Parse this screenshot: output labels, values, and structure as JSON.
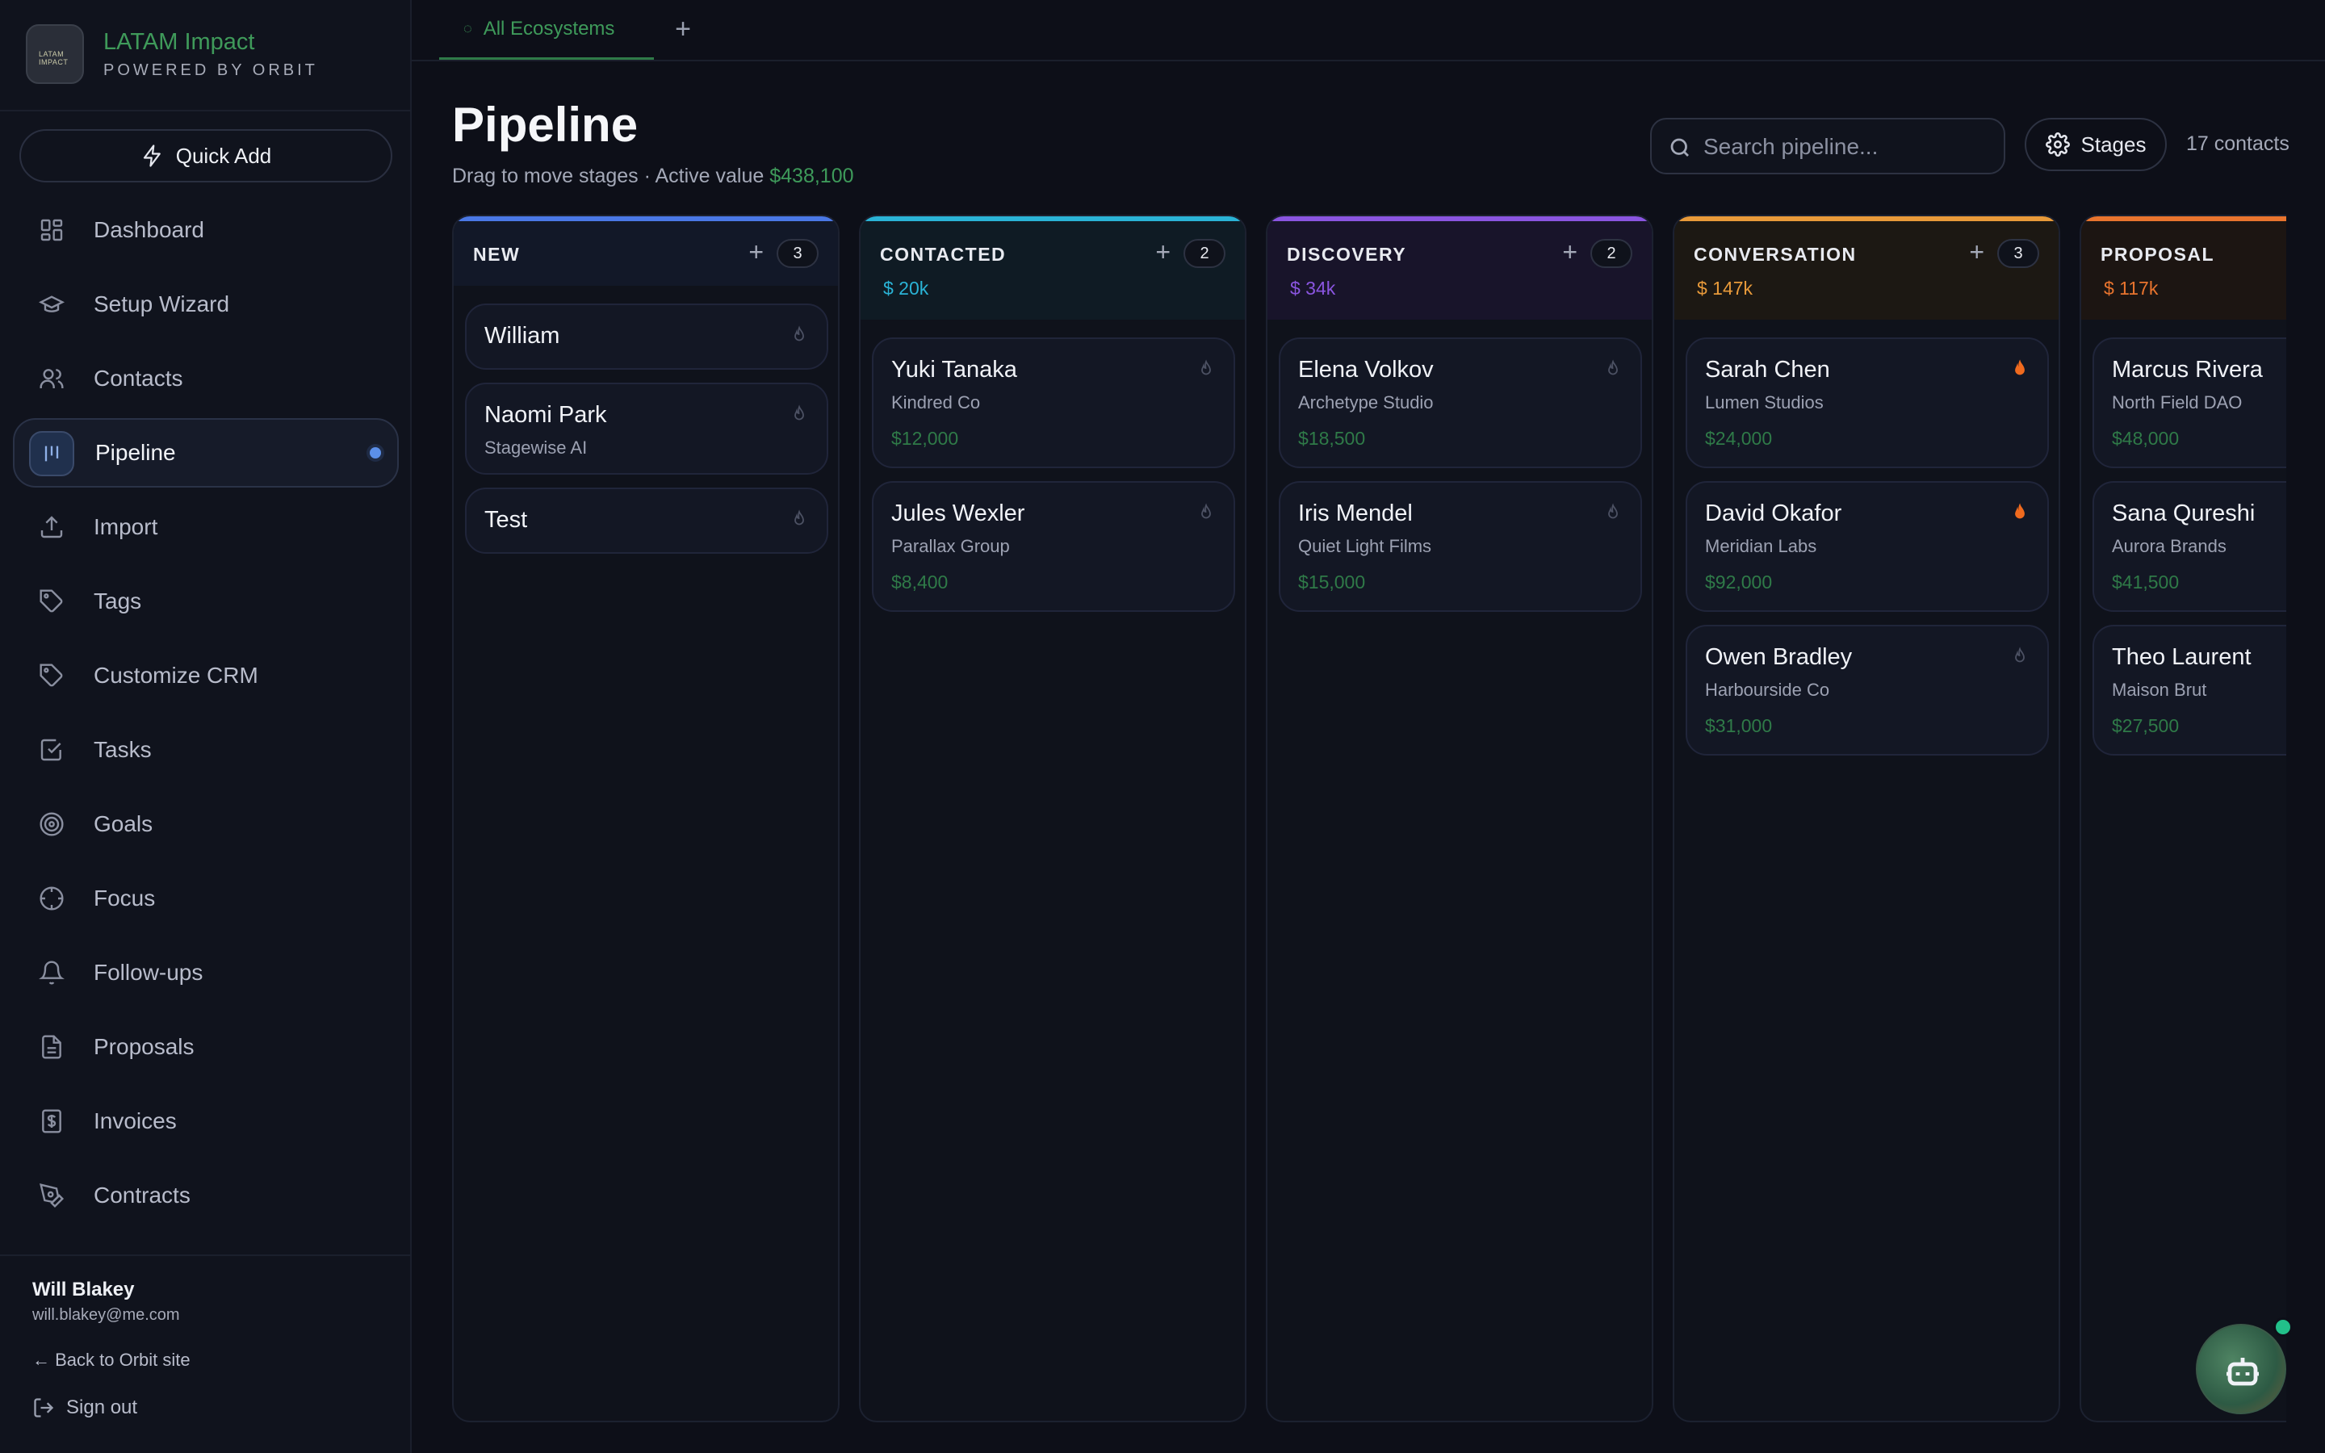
{
  "brand": {
    "title": "LATAM Impact",
    "subtitle": "POWERED BY ORBIT",
    "logo_text": "LATAM IMPACT"
  },
  "quick_add": "Quick Add",
  "nav": [
    {
      "label": "Dashboard",
      "icon": "dashboard-icon"
    },
    {
      "label": "Setup Wizard",
      "icon": "graduation-cap-icon"
    },
    {
      "label": "Contacts",
      "icon": "users-icon"
    },
    {
      "label": "Pipeline",
      "icon": "pipeline-icon",
      "active": true
    },
    {
      "label": "Import",
      "icon": "upload-icon"
    },
    {
      "label": "Tags",
      "icon": "tag-icon"
    },
    {
      "label": "Customize CRM",
      "icon": "tag-icon"
    },
    {
      "label": "Tasks",
      "icon": "checkbox-icon"
    },
    {
      "label": "Goals",
      "icon": "target-icon"
    },
    {
      "label": "Focus",
      "icon": "crosshair-icon"
    },
    {
      "label": "Follow-ups",
      "icon": "bell-icon"
    },
    {
      "label": "Proposals",
      "icon": "file-icon"
    },
    {
      "label": "Invoices",
      "icon": "receipt-icon"
    },
    {
      "label": "Contracts",
      "icon": "pen-icon"
    }
  ],
  "user": {
    "name": "Will Blakey",
    "email": "will.blakey@me.com",
    "back_link": "← Back to Orbit site",
    "sign_out": "Sign out"
  },
  "tabs": {
    "active": "All Ecosystems",
    "add": "+"
  },
  "header": {
    "title": "Pipeline",
    "subtitle_prefix": "Drag to move stages · Active value",
    "active_value": "$438,100",
    "search_placeholder": "Search pipeline...",
    "stages_button": "Stages",
    "contacts_count": "17 contacts"
  },
  "colors": {
    "accent_green": "#3e9a5a",
    "new": "#4a78e6",
    "contacted": "#2ab3d6",
    "discovery": "#8a55e0",
    "conversation": "#e89a3a",
    "proposal": "#e8742e",
    "hot_flame": "#f06a1e"
  },
  "columns": [
    {
      "name": "NEW",
      "count": "3",
      "value": "",
      "color": "#4a78e6",
      "tint": "#121828",
      "cards": [
        {
          "name": "William",
          "company": "",
          "value": "",
          "hot": false
        },
        {
          "name": "Naomi Park",
          "company": "Stagewise AI",
          "value": "",
          "hot": false
        },
        {
          "name": "Test",
          "company": "",
          "value": "",
          "hot": false
        }
      ]
    },
    {
      "name": "CONTACTED",
      "count": "2",
      "value": "$ 20k",
      "color": "#2ab3d6",
      "tint": "#0f1b24",
      "cards": [
        {
          "name": "Yuki Tanaka",
          "company": "Kindred Co",
          "value": "$12,000",
          "hot": false
        },
        {
          "name": "Jules Wexler",
          "company": "Parallax Group",
          "value": "$8,400",
          "hot": false
        }
      ]
    },
    {
      "name": "DISCOVERY",
      "count": "2",
      "value": "$ 34k",
      "color": "#8a55e0",
      "tint": "#18142a",
      "cards": [
        {
          "name": "Elena Volkov",
          "company": "Archetype Studio",
          "value": "$18,500",
          "hot": false
        },
        {
          "name": "Iris Mendel",
          "company": "Quiet Light Films",
          "value": "$15,000",
          "hot": false
        }
      ]
    },
    {
      "name": "CONVERSATION",
      "count": "3",
      "value": "$ 147k",
      "color": "#e89a3a",
      "tint": "#1c1813",
      "cards": [
        {
          "name": "Sarah Chen",
          "company": "Lumen Studios",
          "value": "$24,000",
          "hot": true
        },
        {
          "name": "David Okafor",
          "company": "Meridian Labs",
          "value": "$92,000",
          "hot": true
        },
        {
          "name": "Owen Bradley",
          "company": "Harbourside Co",
          "value": "$31,000",
          "hot": false
        }
      ]
    },
    {
      "name": "PROPOSAL",
      "count": "",
      "value": "$ 117k",
      "color": "#e8742e",
      "tint": "#1c1512",
      "cards": [
        {
          "name": "Marcus Rivera",
          "company": "North Field DAO",
          "value": "$48,000",
          "hot": false
        },
        {
          "name": "Sana Qureshi",
          "company": "Aurora Brands",
          "value": "$41,500",
          "hot": false
        },
        {
          "name": "Theo Laurent",
          "company": "Maison Brut",
          "value": "$27,500",
          "hot": false
        }
      ]
    }
  ]
}
